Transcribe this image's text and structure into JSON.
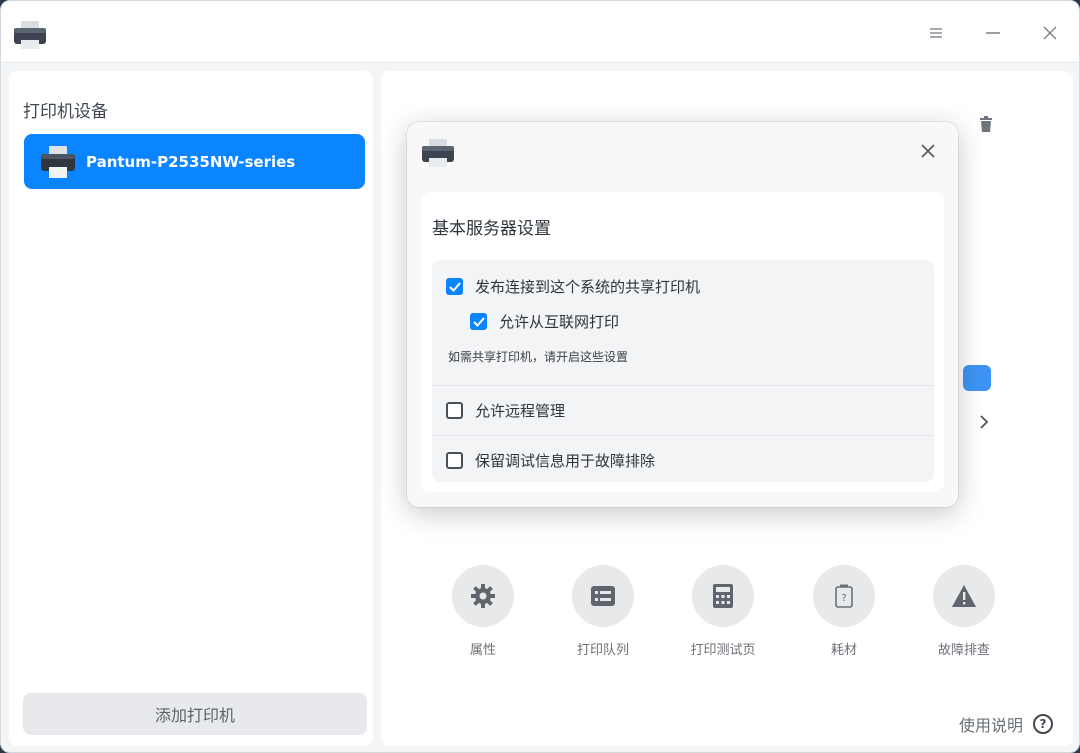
{
  "window": {
    "buttons": {
      "menu_icon": "menu-icon",
      "minimize_icon": "minimize-icon",
      "close_icon": "close-icon"
    }
  },
  "sidebar": {
    "title": "打印机设备",
    "printers": [
      {
        "label": "Pantum-P2535NW-series",
        "selected": true
      }
    ],
    "add_button": "添加打印机"
  },
  "content": {
    "actions": [
      {
        "label": "属性",
        "icon": "gear-icon"
      },
      {
        "label": "打印队列",
        "icon": "queue-icon"
      },
      {
        "label": "打印测试页",
        "icon": "test-page-icon"
      },
      {
        "label": "耗材",
        "icon": "supplies-icon"
      },
      {
        "label": "故障排查",
        "icon": "warning-icon"
      }
    ],
    "help_label": "使用说明"
  },
  "dialog": {
    "section_title": "基本服务器设置",
    "options": {
      "publish_shared": {
        "label": "发布连接到这个系统的共享打印机",
        "checked": true
      },
      "allow_internet": {
        "label": "允许从互联网打印",
        "checked": true
      },
      "hint": "如需共享打印机，请开启这些设置",
      "remote_admin": {
        "label": "允许远程管理",
        "checked": false
      },
      "debug_info": {
        "label": "保留调试信息用于故障排除",
        "checked": false
      }
    }
  },
  "colors": {
    "accent": "#0a84ff",
    "window_bg": "#f4f5f6"
  }
}
